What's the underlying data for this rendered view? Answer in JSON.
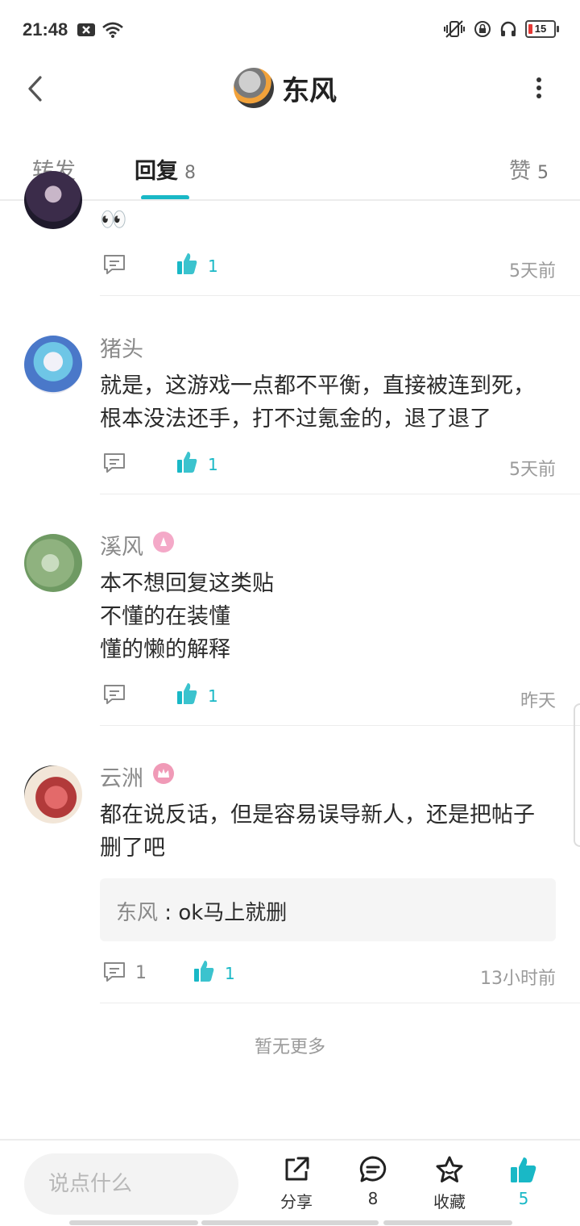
{
  "status_bar": {
    "time": "21:48",
    "battery": "15"
  },
  "header": {
    "title": "东风"
  },
  "tabs": [
    {
      "label": "转发",
      "count": ""
    },
    {
      "label": "回复",
      "count": "8"
    },
    {
      "label": "赞",
      "count": "5"
    }
  ],
  "comments": [
    {
      "username": "",
      "text": "👀",
      "likes": "1",
      "replies": "",
      "time": "5天前"
    },
    {
      "username": "猪头",
      "text_lines": [
        "就是，这游戏一点都不平衡，直接被连到死，",
        "根本没法还手，打不过氪金的，退了退了"
      ],
      "likes": "1",
      "replies": "",
      "time": "5天前"
    },
    {
      "username": "溪风",
      "text_lines": [
        "本不想回复这类贴",
        "不懂的在装懂",
        "懂的懒的解释"
      ],
      "likes": "1",
      "replies": "",
      "time": "昨天"
    },
    {
      "username": "云洲",
      "text_lines": [
        "都在说反话，但是容易误导新人，还是把帖子",
        "删了吧"
      ],
      "quote": {
        "name": "东风",
        "sep": " : ",
        "text": "ok马上就删"
      },
      "likes": "1",
      "replies": "1",
      "time": "13小时前"
    }
  ],
  "no_more": "暂无更多",
  "bottom_bar": {
    "input_placeholder": "说点什么",
    "share": "分享",
    "comment_count": "8",
    "favorite": "收藏",
    "like_count": "5"
  },
  "colors": {
    "accent": "#19b8c6",
    "text": "#2b2b2b",
    "muted": "#8a8a8a"
  }
}
